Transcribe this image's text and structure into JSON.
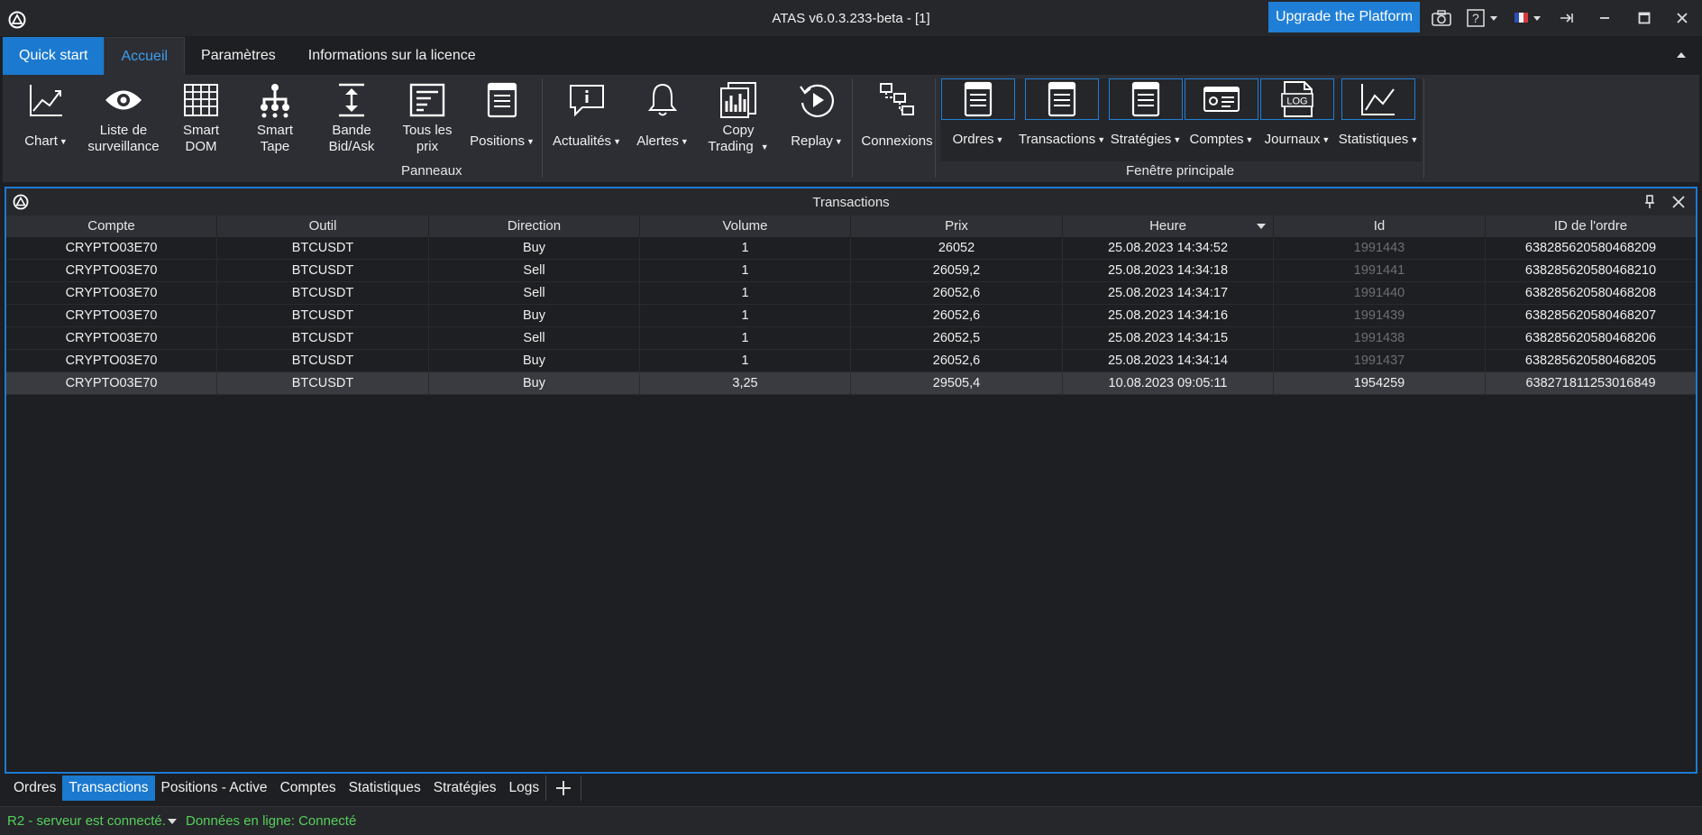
{
  "window": {
    "title": "ATAS v6.0.3.233-beta - [1]",
    "upgrade_label": "Upgrade the Platform"
  },
  "ribbon_tabs": [
    "Quick start",
    "Accueil",
    "Paramètres",
    "Informations sur la licence"
  ],
  "ribbon": {
    "panneaux_label": "Panneaux",
    "main_window_label": "Fenêtre principale",
    "buttons": {
      "chart": "Chart",
      "watchlist_1": "Liste de",
      "watchlist_2": "surveillance",
      "smartdom_1": "Smart",
      "smartdom_2": "DOM",
      "smarttape_1": "Smart",
      "smarttape_2": "Tape",
      "bidask_1": "Bande",
      "bidask_2": "Bid/Ask",
      "allprices_1": "Tous les",
      "allprices_2": "prix",
      "positions": "Positions",
      "news": "Actualités",
      "alerts": "Alertes",
      "copy_1": "Copy",
      "copy_2": "Trading",
      "replay": "Replay",
      "connections": "Connexions",
      "orders": "Ordres",
      "transactions": "Transactions",
      "strategies": "Stratégies",
      "accounts": "Comptes",
      "journals": "Journaux",
      "log_badge": "LOG",
      "statistics": "Statistiques"
    }
  },
  "panel": {
    "title": "Transactions",
    "columns": [
      "Compte",
      "Outil",
      "Direction",
      "Volume",
      "Prix",
      "Heure",
      "Id",
      "ID de l'ordre"
    ],
    "rows": [
      [
        "CRYPTO03E70",
        "BTCUSDT",
        "Buy",
        "1",
        "26052",
        "25.08.2023 14:34:52",
        "1991443",
        "638285620580468209"
      ],
      [
        "CRYPTO03E70",
        "BTCUSDT",
        "Sell",
        "1",
        "26059,2",
        "25.08.2023 14:34:18",
        "1991441",
        "638285620580468210"
      ],
      [
        "CRYPTO03E70",
        "BTCUSDT",
        "Sell",
        "1",
        "26052,6",
        "25.08.2023 14:34:17",
        "1991440",
        "638285620580468208"
      ],
      [
        "CRYPTO03E70",
        "BTCUSDT",
        "Buy",
        "1",
        "26052,6",
        "25.08.2023 14:34:16",
        "1991439",
        "638285620580468207"
      ],
      [
        "CRYPTO03E70",
        "BTCUSDT",
        "Sell",
        "1",
        "26052,5",
        "25.08.2023 14:34:15",
        "1991438",
        "638285620580468206"
      ],
      [
        "CRYPTO03E70",
        "BTCUSDT",
        "Buy",
        "1",
        "26052,6",
        "25.08.2023 14:34:14",
        "1991437",
        "638285620580468205"
      ],
      [
        "CRYPTO03E70",
        "BTCUSDT",
        "Buy",
        "3,25",
        "29505,4",
        "10.08.2023 09:05:11",
        "1954259",
        "638271811253016849"
      ]
    ]
  },
  "bottom_tabs": [
    "Ordres",
    "Transactions",
    "Positions - Active",
    "Comptes",
    "Statistiques",
    "Stratégies",
    "Logs"
  ],
  "status": {
    "server": "R2 - serveur est connecté.",
    "data": "Données en ligne: Connecté"
  },
  "colors": {
    "accent": "#1f7fd6",
    "status_ok": "#54d05a"
  }
}
